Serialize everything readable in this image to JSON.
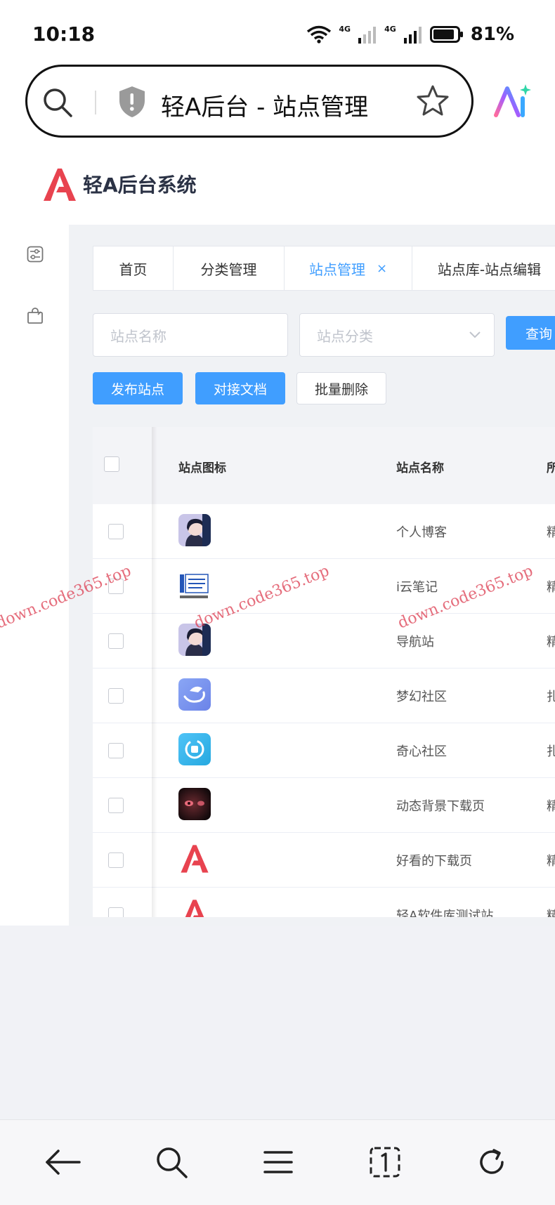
{
  "status": {
    "time": "10:18",
    "battery": "81%",
    "net1": "4G",
    "net2": "4G"
  },
  "browser": {
    "url_title": "轻A后台 - 站点管理"
  },
  "app": {
    "title": "轻A后台系统"
  },
  "tabs": [
    {
      "label": "首页"
    },
    {
      "label": "分类管理"
    },
    {
      "label": "站点管理",
      "close": "×"
    },
    {
      "label": "站点库-站点编辑"
    }
  ],
  "filters": {
    "name_placeholder": "站点名称",
    "category_placeholder": "站点分类",
    "query_label": "查询"
  },
  "actions": {
    "publish": "发布站点",
    "docs": "对接文档",
    "batch_delete": "批量删除"
  },
  "table": {
    "columns": {
      "icon": "站点图标",
      "name": "站点名称",
      "extra": "所"
    },
    "rows": [
      {
        "name": "个人博客",
        "extra": "精",
        "icon": "avatar-anime"
      },
      {
        "name": "i云笔记",
        "extra": "精",
        "icon": "icloud-notes-logo"
      },
      {
        "name": "导航站",
        "extra": "精",
        "icon": "avatar-anime"
      },
      {
        "name": "梦幻社区",
        "extra": "扎",
        "icon": "dream-community-logo"
      },
      {
        "name": "奇心社区",
        "extra": "扎",
        "icon": "qixin-community-logo"
      },
      {
        "name": "动态背景下载页",
        "extra": "精",
        "icon": "dark-portrait"
      },
      {
        "name": "好看的下载页",
        "extra": "精",
        "icon": "red-a-logo"
      },
      {
        "name": "轻A软件库测试站",
        "extra": "精",
        "icon": "red-a-logo"
      }
    ]
  },
  "watermark": "down.code365.top",
  "colors": {
    "primary": "#409eff",
    "brand_red": "#e8434f",
    "border": "#dcdfe6"
  }
}
